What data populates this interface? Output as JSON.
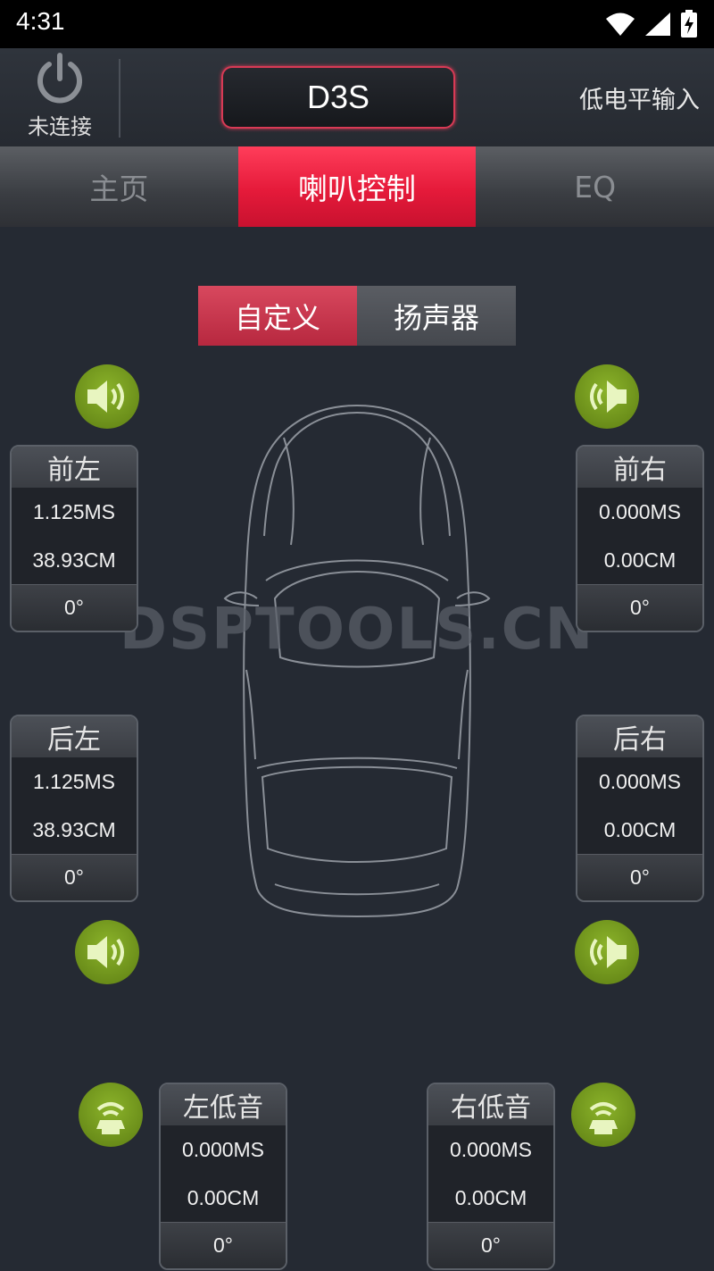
{
  "status": {
    "time": "4:31"
  },
  "header": {
    "connection": "未连接",
    "device": "D3S",
    "input_mode": "低电平输入"
  },
  "tabs": [
    {
      "label": "主页",
      "active": false
    },
    {
      "label": "喇叭控制",
      "active": true
    },
    {
      "label": "EQ",
      "active": false
    }
  ],
  "segment": {
    "custom": "自定义",
    "speaker": "扬声器"
  },
  "watermark": "DSPTOOLS.CN",
  "channels": {
    "front_left": {
      "name": "前左",
      "delay": "1.125MS",
      "distance": "38.93CM",
      "phase": "0°"
    },
    "front_right": {
      "name": "前右",
      "delay": "0.000MS",
      "distance": "0.00CM",
      "phase": "0°"
    },
    "rear_left": {
      "name": "后左",
      "delay": "1.125MS",
      "distance": "38.93CM",
      "phase": "0°"
    },
    "rear_right": {
      "name": "后右",
      "delay": "0.000MS",
      "distance": "0.00CM",
      "phase": "0°"
    },
    "sub_left": {
      "name": "左低音",
      "delay": "0.000MS",
      "distance": "0.00CM",
      "phase": "0°"
    },
    "sub_right": {
      "name": "右低音",
      "delay": "0.000MS",
      "distance": "0.00CM",
      "phase": "0°"
    }
  },
  "colors": {
    "accent": "#e51a3a",
    "speaker_green": "#7aa322",
    "background": "#252a33"
  }
}
